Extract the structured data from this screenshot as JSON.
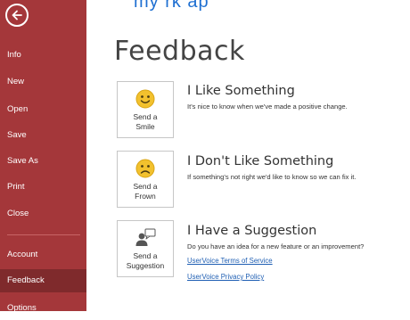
{
  "header": {
    "cut_title": "my  rk  ap"
  },
  "sidebar": {
    "items": [
      {
        "id": "info",
        "label": "Info"
      },
      {
        "id": "new",
        "label": "New"
      },
      {
        "id": "open",
        "label": "Open"
      },
      {
        "id": "save",
        "label": "Save"
      },
      {
        "id": "save-as",
        "label": "Save As"
      },
      {
        "id": "print",
        "label": "Print"
      },
      {
        "id": "close",
        "label": "Close"
      },
      {
        "id": "account",
        "label": "Account"
      },
      {
        "id": "feedback",
        "label": "Feedback"
      },
      {
        "id": "options",
        "label": "Options"
      }
    ],
    "active": "feedback"
  },
  "main": {
    "title": "Feedback",
    "sections": [
      {
        "title": "I Like Something",
        "description": "It's nice to know when we've made a positive change.",
        "button_label": "Send a\nSmile",
        "icon": "smile-icon"
      },
      {
        "title": "I Don't Like Something",
        "description": "If something's not right we'd like to know so we can fix it.",
        "button_label": "Send a\nFrown",
        "icon": "frown-icon"
      },
      {
        "title": "I Have a Suggestion",
        "description": "Do you have an idea for a new feature or an improvement?",
        "button_label": "Send a\nSuggestion",
        "icon": "suggestion-icon",
        "links": [
          "UserVoice Terms of Service",
          "UserVoice Privacy Policy"
        ]
      }
    ]
  },
  "colors": {
    "sidebar_bg": "#a4373a",
    "sidebar_active": "#7f2a2c",
    "link": "#1f5fb3",
    "emoji_yellow": "#f2c12e"
  }
}
